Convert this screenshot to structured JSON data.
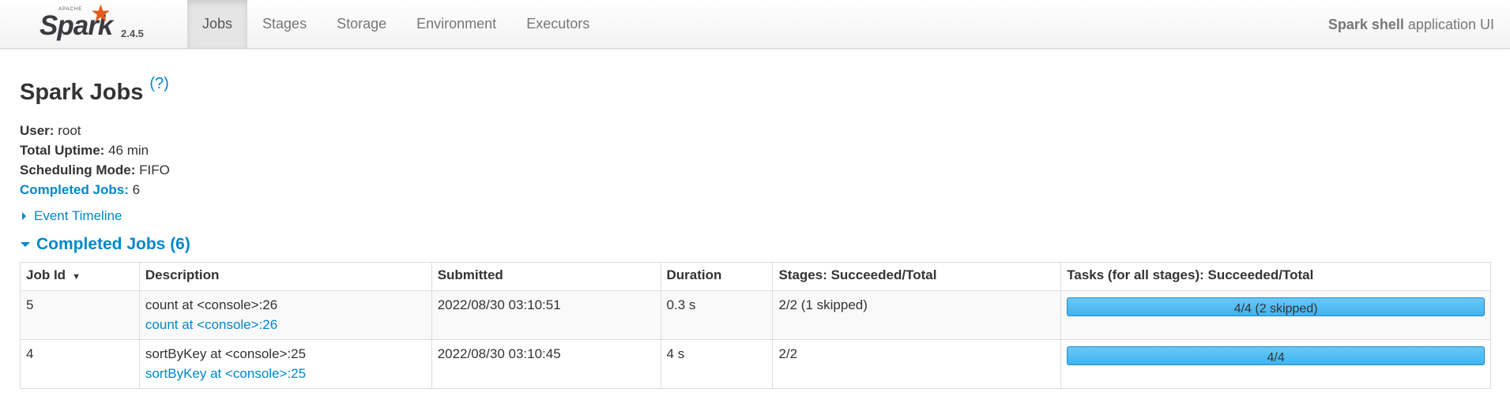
{
  "brand": {
    "apache": "APACHE",
    "name": "Spark",
    "version": "2.4.5"
  },
  "nav": {
    "tabs": [
      "Jobs",
      "Stages",
      "Storage",
      "Environment",
      "Executors"
    ],
    "active": "Jobs"
  },
  "app": {
    "name": "Spark shell",
    "suffix": "application UI"
  },
  "page": {
    "title": "Spark Jobs",
    "help": "(?)"
  },
  "info": {
    "user_label": "User:",
    "user": "root",
    "uptime_label": "Total Uptime:",
    "uptime": "46 min",
    "mode_label": "Scheduling Mode:",
    "mode": "FIFO",
    "completed_label": "Completed Jobs:",
    "completed": "6"
  },
  "timeline": {
    "label": "Event Timeline"
  },
  "section": {
    "title": "Completed Jobs (6)"
  },
  "table": {
    "headers": [
      "Job Id",
      "Description",
      "Submitted",
      "Duration",
      "Stages: Succeeded/Total",
      "Tasks (for all stages): Succeeded/Total"
    ],
    "sort_indicator": "▼",
    "rows": [
      {
        "id": "5",
        "desc": "count at <console>:26",
        "desc_link": "count at <console>:26",
        "submitted": "2022/08/30 03:10:51",
        "duration": "0.3 s",
        "stages": "2/2 (1 skipped)",
        "tasks": "4/4 (2 skipped)",
        "tasks_progress": 1.0
      },
      {
        "id": "4",
        "desc": "sortByKey at <console>:25",
        "desc_link": "sortByKey at <console>:25",
        "submitted": "2022/08/30 03:10:45",
        "duration": "4 s",
        "stages": "2/2",
        "tasks": "4/4",
        "tasks_progress": 1.0
      }
    ]
  },
  "colors": {
    "link": "#0088cc",
    "brand_orange": "#e25a1c",
    "progress_fill": "#3eb4f0"
  }
}
